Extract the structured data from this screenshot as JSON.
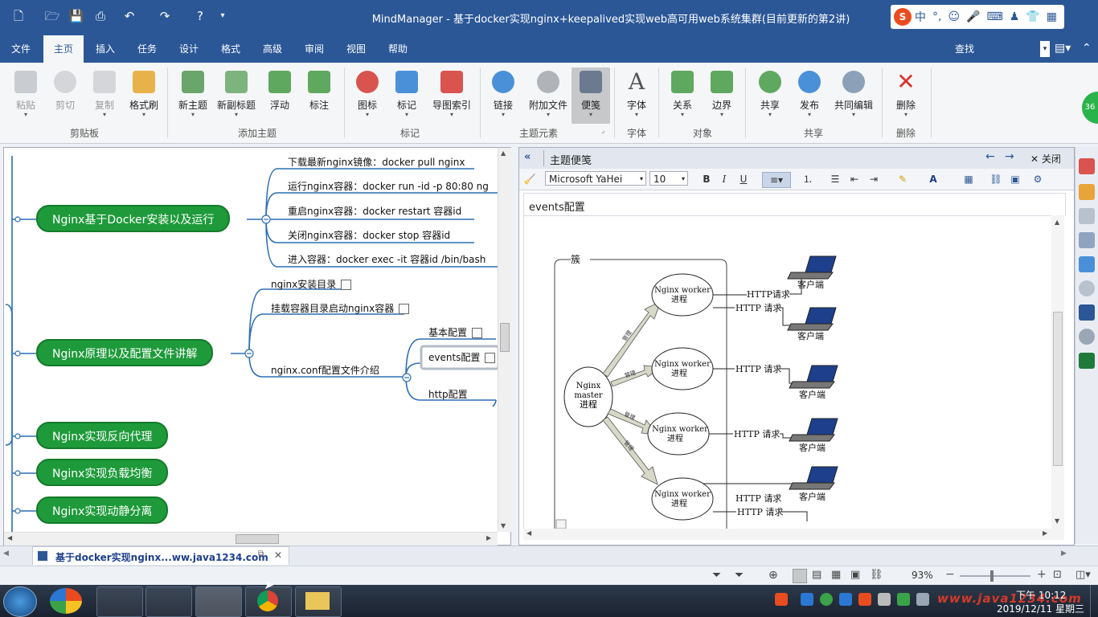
{
  "window": {
    "title": "MindManager - 基于docker实现nginx+keepalived实现web高可用web系统集群(目前更新的第2讲)",
    "ime": {
      "chinese": "中",
      "punct": "°,"
    }
  },
  "menu": {
    "items": [
      "文件",
      "主页",
      "插入",
      "任务",
      "设计",
      "格式",
      "高级",
      "审阅",
      "视图",
      "帮助"
    ],
    "active": "主页",
    "search_label": "查找"
  },
  "ribbon": {
    "clipboard": {
      "paste": "粘贴",
      "cut": "剪切",
      "copy": "复制",
      "format_painter": "格式刷",
      "group": "剪贴板"
    },
    "add_topic": {
      "new_topic": "新主题",
      "new_subtopic": "新副标题",
      "floating": "浮动",
      "callout": "标注",
      "group": "添加主题"
    },
    "markers": {
      "icon": "图标",
      "tag": "标记",
      "map_index": "导图索引",
      "group": "标记"
    },
    "topic_elements": {
      "link": "链接",
      "attachment": "附加文件",
      "notes": "便笺",
      "group": "主题元素"
    },
    "font": {
      "font": "字体",
      "group": "字体"
    },
    "objects": {
      "relation": "关系",
      "boundary": "边界",
      "group": "对象"
    },
    "share": {
      "share": "共享",
      "publish": "发布",
      "co_edit": "共同编辑",
      "group": "共享"
    },
    "delete": {
      "delete": "删除",
      "group": "删除"
    }
  },
  "map": {
    "topics": [
      {
        "label": "Nginx基于Docker安装以及运行"
      },
      {
        "label": "Nginx原理以及配置文件讲解"
      },
      {
        "label": "Nginx实现反向代理"
      },
      {
        "label": "Nginx实现负载均衡"
      },
      {
        "label": "Nginx实现动静分离"
      }
    ],
    "install_subtopics": [
      "下载最新nginx镜像：docker pull nginx",
      "运行nginx容器：docker run -id -p 80:80  ng",
      "重启nginx容器：docker restart 容器id",
      "关闭nginx容器：docker stop 容器id",
      "进入容器：docker exec -it 容器id /bin/bash"
    ],
    "principle_subtopics": {
      "install_dir": "nginx安装目录",
      "mount": "挂载容器目录启动nginx容器",
      "conf": "nginx.conf配置文件介绍",
      "basic": "基本配置",
      "events": "events配置",
      "http": "http配置"
    }
  },
  "notes": {
    "header_title": "主题便笺",
    "close_label": "关闭",
    "font_family": "Microsoft YaHei",
    "font_size": "10",
    "bold": "B",
    "italic": "I",
    "underline": "U",
    "note_title": "events配置",
    "diagram": {
      "cluster": "簇",
      "master_line1": "Nginx",
      "master_line2": "master",
      "master_line3": "进程",
      "worker_line1": "Nginx worker",
      "worker_line2": "进程",
      "http_request": "HTTP请求",
      "http_request_spaced": "HTTP 请求",
      "client": "客户端",
      "arrow_label": "管理"
    }
  },
  "tabs": {
    "document": "基于docker实现nginx...ww.java1234.com"
  },
  "status": {
    "zoom": "93%"
  },
  "taskbar": {
    "time": "下午 10:12",
    "date": "2019/12/11 星期三",
    "watermark": "www.java1234.com"
  }
}
